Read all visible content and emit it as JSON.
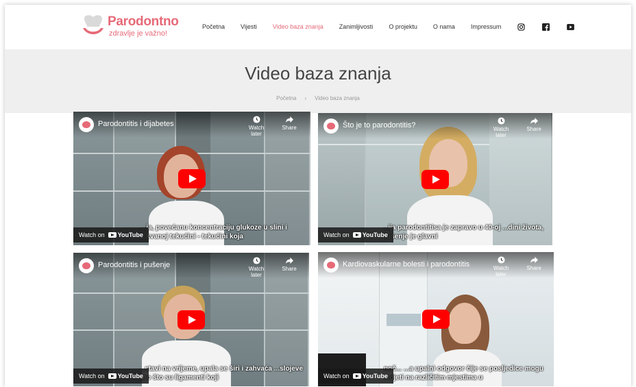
{
  "brand": {
    "title": "Parodontno",
    "subtitle": "zdravlje je važno!",
    "accent": "#e66a78"
  },
  "nav": {
    "items": [
      {
        "label": "Početna",
        "active": false
      },
      {
        "label": "Vijesti",
        "active": false
      },
      {
        "label": "Video baza znanja",
        "active": true
      },
      {
        "label": "Zanimljivosti",
        "active": false
      },
      {
        "label": "O projektu",
        "active": false
      },
      {
        "label": "O nama",
        "active": false
      },
      {
        "label": "Impressum",
        "active": false
      }
    ],
    "social": [
      "instagram-icon",
      "facebook-icon",
      "youtube-icon"
    ]
  },
  "page": {
    "title": "Video baza znanja",
    "breadcrumb": [
      "Početna",
      "›",
      "Video baza znanja"
    ]
  },
  "videos": [
    {
      "title": "Parodontitis i dijabetes",
      "watch_later": "Watch later",
      "share": "Share",
      "watch_on": "Watch on",
      "yt": "YouTube",
      "caption": "...ja, povećanu koncentraciju glukoze u slini i ...kvanoj tekućini - tekućini koja"
    },
    {
      "title": "Što je to parodontitis?",
      "watch_later": "Watch later",
      "share": "Share",
      "watch_on": "Watch on",
      "yt": "YouTube",
      "caption": "...ija parodontitisa je zapravo u 40-oj ...dini života, pušenje je glavni"
    },
    {
      "title": "Parodontitis i pušenje",
      "watch_later": "Watch later",
      "share": "Share",
      "watch_on": "Watch on",
      "yt": "YouTube",
      "caption": "...stavi na vrijeme, upala se širi i zahvaća ...slojeve kao što su ligamenti koji"
    },
    {
      "title": "Kardiovaskularne bolesti i parodontitis",
      "watch_later": "Watch later",
      "share": "Share",
      "watch_on": "Watch on",
      "yt": "YouTube",
      "caption": "noč... ...a upalni odgovor čije se posljedice mogu ...djeti na različitim mjestima u"
    }
  ]
}
